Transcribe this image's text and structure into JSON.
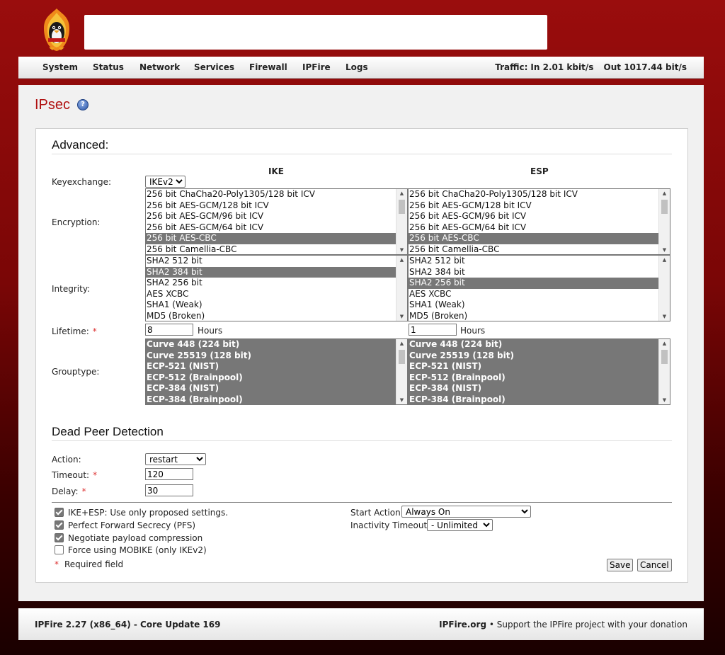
{
  "nav": {
    "items": [
      "System",
      "Status",
      "Network",
      "Services",
      "Firewall",
      "IPFire",
      "Logs"
    ],
    "traffic_label": "Traffic:",
    "traffic_in": "In 2.01 kbit/s",
    "traffic_out": "Out 1017.44 bit/s"
  },
  "page": {
    "title": "IPsec",
    "help_glyph": "?"
  },
  "advanced": {
    "title": "Advanced:",
    "col_ike": "IKE",
    "col_esp": "ESP",
    "keyexchange_label": "Keyexchange:",
    "keyexchange_value": "IKEv2",
    "encryption_label": "Encryption:",
    "encryption_options": [
      "256 bit ChaCha20-Poly1305/128 bit ICV",
      "256 bit AES-GCM/128 bit ICV",
      "256 bit AES-GCM/96 bit ICV",
      "256 bit AES-GCM/64 bit ICV",
      "256 bit AES-CBC",
      "256 bit Camellia-CBC"
    ],
    "encryption_ike_selected": [
      false,
      false,
      false,
      false,
      true,
      false
    ],
    "encryption_esp_selected": [
      false,
      false,
      false,
      false,
      true,
      false
    ],
    "integrity_label": "Integrity:",
    "integrity_options": [
      "SHA2 512 bit",
      "SHA2 384 bit",
      "SHA2 256 bit",
      "AES XCBC",
      "SHA1 (Weak)",
      "MD5 (Broken)"
    ],
    "integrity_ike_selected": [
      false,
      true,
      false,
      false,
      false,
      false
    ],
    "integrity_esp_selected": [
      false,
      false,
      true,
      false,
      false,
      false
    ],
    "lifetime_label": "Lifetime:",
    "required_mark": "*",
    "lifetime_ike": "8",
    "lifetime_esp": "1",
    "hours_label": "Hours",
    "grouptype_label": "Grouptype:",
    "grouptype_options": [
      "Curve 448 (224 bit)",
      "Curve 25519 (128 bit)",
      "ECP-521 (NIST)",
      "ECP-512 (Brainpool)",
      "ECP-384 (NIST)",
      "ECP-384 (Brainpool)"
    ],
    "grouptype_ike_selected": [
      true,
      true,
      true,
      true,
      true,
      true
    ],
    "grouptype_esp_selected": [
      true,
      true,
      true,
      true,
      true,
      true
    ]
  },
  "dpd": {
    "title": "Dead Peer Detection",
    "action_label": "Action:",
    "action_value": "restart",
    "timeout_label": "Timeout:",
    "timeout_value": "120",
    "delay_label": "Delay:",
    "delay_value": "30"
  },
  "options": {
    "checkboxes": [
      {
        "label": "IKE+ESP: Use only proposed settings.",
        "checked": true
      },
      {
        "label": "Perfect Forward Secrecy (PFS)",
        "checked": true
      },
      {
        "label": "Negotiate payload compression",
        "checked": true
      },
      {
        "label": "Force using MOBIKE (only IKEv2)",
        "checked": false
      }
    ],
    "required_field": "Required field",
    "start_action_label": "Start Action",
    "start_action_value": "Always On",
    "inactivity_label": "Inactivity Timeout",
    "inactivity_value": "- Unlimited -",
    "save_label": "Save",
    "cancel_label": "Cancel"
  },
  "footer": {
    "version": "IPFire 2.27 (x86_64) - Core Update 169",
    "site": "IPFire.org",
    "bullet": "•",
    "support_text": "Support the IPFire project with your donation"
  },
  "colors": {
    "accent": "#b01010",
    "header_bg": "#8b0a0a",
    "selected_option": "#777777"
  }
}
